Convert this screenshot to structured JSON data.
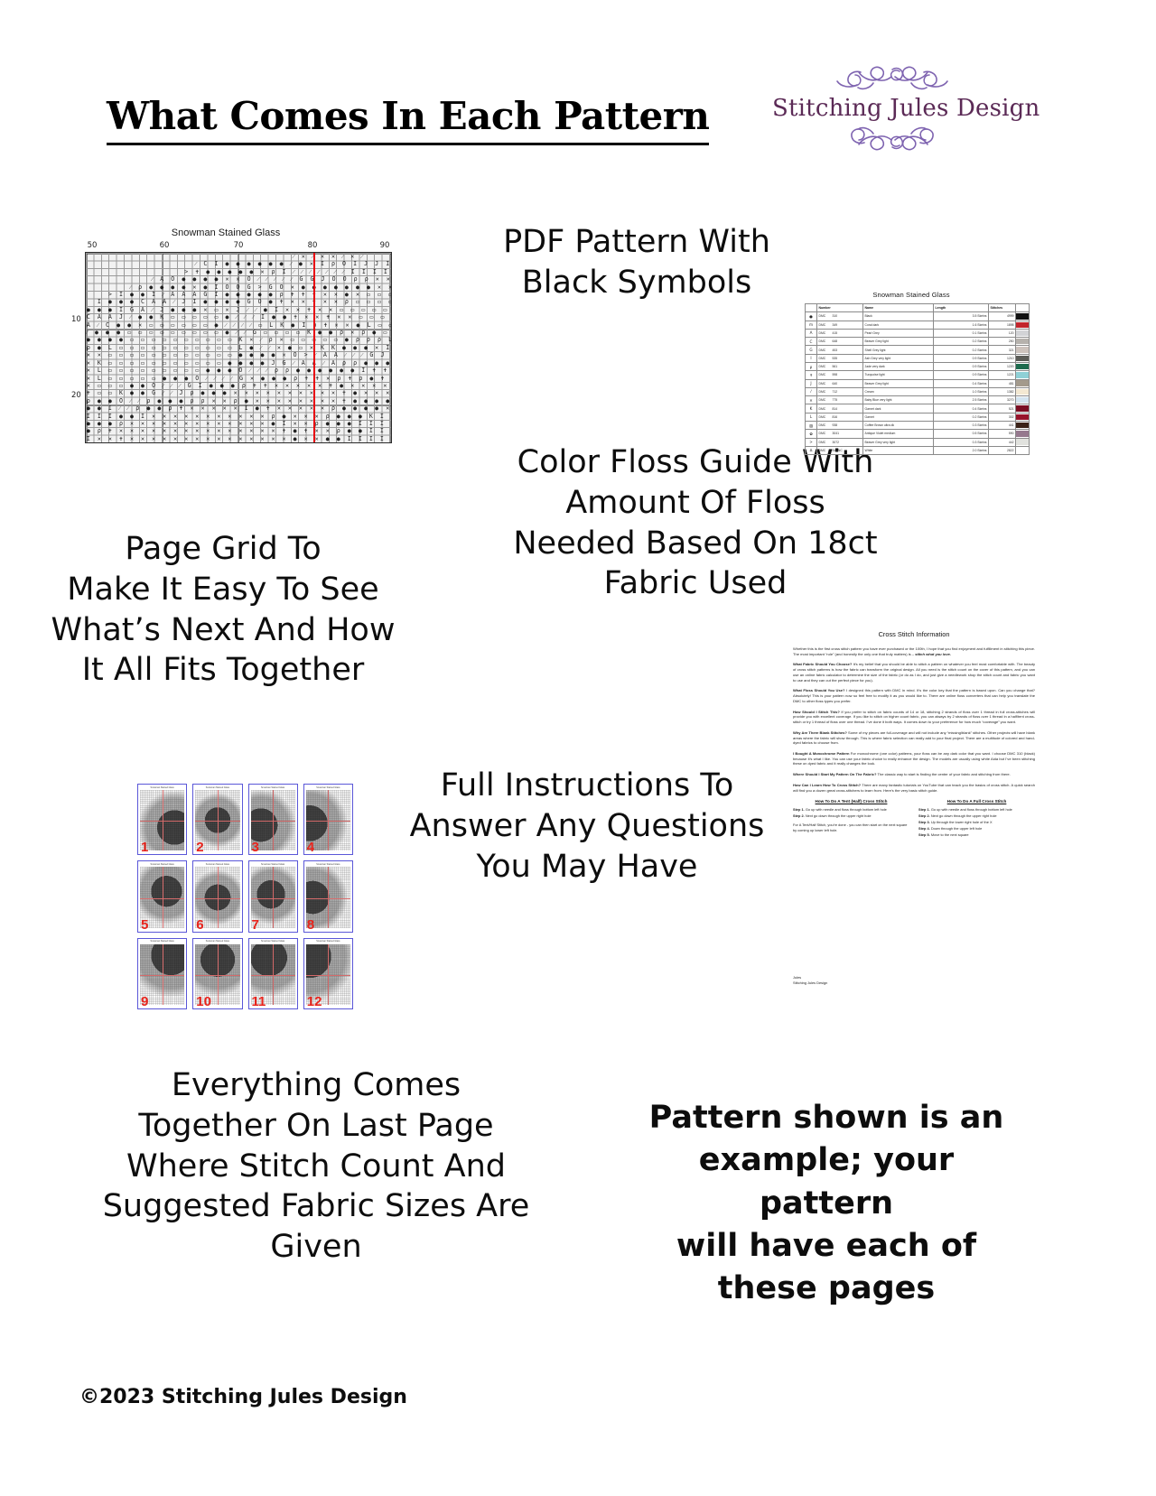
{
  "page": {
    "title": "What Comes In Each Pattern",
    "footer": "©2023 Stitching Jules Design"
  },
  "logo": {
    "name": "Stitching Jules Design",
    "color": "#5b2a56",
    "flourish_color": "#7e63b0"
  },
  "captions": {
    "pdf_pattern": "PDF Pattern With\nBlack Symbols",
    "page_grid": "Page Grid To\nMake It Easy To See\nWhat’s Next And How\nIt All Fits Together",
    "color_floss": "Color Floss Guide With\nAmount Of Floss\nNeeded Based On 18ct\nFabric Used",
    "full_instructions": "Full Instructions To\nAnswer Any Questions\nYou May Have",
    "everything_comes": "Everything Comes\nTogether On Last Page\nWhere Stitch Count And\nSuggested Fabric Sizes Are\nGiven",
    "disclaimer": "Pattern shown is an\nexample; your pattern\nwill have each of\nthese pages"
  },
  "chart": {
    "title": "Snowman Stained Glass",
    "column_labels": [
      "50",
      "60",
      "70",
      "80",
      "90"
    ],
    "row_labels": [
      "10",
      "20"
    ],
    "centerline_color": "#e8000d",
    "symbol_rows": [
      "                                      ⁄ ✕ ⁄ ✕ ✕ ⁄ ✕ ⁄",
      "                    ⁄ C I ● ● ● ● ● ● ⁄ ● ✕ I ρ O I J J I I I I I I I O O O ρ ● ● ● ● I",
      "                  > ✝ ● ● ● ● ● ✕ ρ I ⁄ ⁄ ⁄ ⁄ ⁄ ⁄ ⁄ I I I I I I I ⁄ ⁄ ⁄ ⁄ ⁄ G J I ● ●",
      "            ⁄ A O ● ● ● ● ✕ ✕ O ⁄ ⁄ ⁄ ⁄ ⁄ G G J O O ρ ρ ✕ ✕ ✕ ρ ρ O I J G ⁄ ⁄ A A ⁄ J",
      "        ⁄ ρ ● ● ● ● ✕ ● I O O G > G O ✕ ● ● ● ● ● ● ● ✕ ✕ ● ● ● ● ● ● ● ✕ I G ⁄ A A ⁄",
      "    > I ● ● I ⁄ A A A G I ● ● ● ● ● ρ ✝ ✝ ✝ ✕ ✕ ● ✕ ▭ ▭ ▭ ▭ ● O ⁄ ● ● ● ● ● ρ ✕ ✕ ✝ ✝ ✕",
      "  I ● ● ● C A A ⁄ J I ● ● ● ● G O ● ✝ ✕ ✕ ✝ ✕ ✕ ρ ▭ ▭ ▭ ▭ ▭ ● O ▭ ● ● ● ● ● ✝ ✕ ✝ ✕ ✕ ✝",
      "● ● ● I G A ⁄ J ● ● ● ✕ ▭ ✕ J ⁄ ⁄ ● I ✕ ✕ ✝ ✕ ✕ ▭ ▭ ▭ ▭ ▭ ● O I ✕ ▭ ▭ ▭ ▭ ● ✕ ✕ ✝ ✕ ✕ ✝ ✕",
      "C A A J ⁄ ● ● K ▭ ▭ ▭ ▭ ▭ ● ⁄ ⁄ ⁄ I ● ● ✝ ✕ ✕ ✝ ✕ ✕ ▭ ▭ ▭ ▭ ● O ✕ ▭ ▭ ▭ ▭ L ● ✝ ✕ ✝ ✕ ✝ ● G",
      "A ⁄ C ● ● ✕ ▭ ▭ ▭ ▭ ▭ ▭ ● ⁄ ⁄ ⁄ ⁄ ▭ L K ● I ρ ✝ ✕ ✕ ● L ▭ ▭ ▭ ● I ● ● ● ● ✕ ✝ ρ ▭ ● ▭ ▭ C",
      "⁄ ● ● ● ▭ ▭ ▭ ▭ ▭ ▭ ▭ ▭ ▭ ● ⁄ ⁄ G ▭ ▭ ▭ ▭ K ● ● ρ ✕ ρ ● ▭ L ● J G ✕ ● ▭ ● ✝ ✕ ● ● L ▭ ▭ ▭ ✕",
      "● ● ● ● ▭ ▭ ▭ ▭ ▭ ▭ ▭ ▭ ▭ ▭ K ✕ ⁄ ρ ✕ ▭ ▭ ▭ ▭ ▭ ● ρ ρ ρ L ● C I ▭ ✕ L ● ✝ ρ ● ▭ ▭ ▭ ▭ ▭ ●",
      "ρ ● L ▭ ▭ ▭ ▭ ▭ ▭ ▭ ▭ ▭ ▭ ▭ L ● ⁄ ⁄ ✕ ● ▭ ✕ K K ● ● ● ✕ I O C O ▭ I ρ O O O O ρ I ✕ ● ● ● ● L ▭ ●",
      "✕ ✕ ▭ ▭ ▭ ▭ ▭ ▭ ▭ ▭ ▭ ▭ ▭ ▭ ● ● ● ● ✕ O > ⁄ A A ⁄ ⁄ ⁄ G J J O O I O O ρ O O G > ⁄ A A A A C ●",
      "✕ K ▭ ▭ ▭ ▭ ▭ ▭ ▭ ▭ ▭ ▭ ▭ ● ● ● ● J G ⁄ A A ⁄ A ρ ρ ● ● ● ● ● ● ● ● ● ● ● ● ● ● ● I C J A A A A ⁄",
      "✕ L ▭ ▭ ▭ ▭ ▭ ▭ ▭ ▭ ▭ ● ● ● O ⁄ ⁄ ⁄ ρ ρ ● ● ● ● ● ● I ✝ ✝ ✕ ✕ ✕ ✕ ✕ ✝ ✕ ✕ ✕ ✕ ✝ ✝ ρ ρ I ● ● ● ● ρ",
      "✕ L ▭ ▭ ▭ ▭ ▭ ● ● ● O ⁄ ⁄ ⁄ ⁄ G ✕ ● ● ● ρ ✝ ✝ ✕ ρ ✝ ρ ● ✝ ✕ ✕ ✕ ✕ ✕ ✕ ✕ ✕ ✕ ✕ ✕ ✕ ✕ ρ ● ● ● ● ρ",
      "✕ ▭ ▭ ▭ ● ● O ⁄ ⁄ ⁄ G I ● ● ● ρ ✝ ✝ ✕ ✕ ✕ ✕ ✕ ✝ ● ✕ ✕ ✕ ✕ ✕ ✕ ✝ ρ ✝ ✝ ✕ ✕ ✕ ✕ ✕ ✕ ✕ ✕ I ✕",
      "✝ ▭ ▭ K ● ● G ⁄ ⁄ J ρ ● ● ● ✕ ✕ ✕ ✕ ✕ ✕ ✕ ✕ ✕ ✕ ✝ ● ✕ ✕ ✕ ✕ ✕ ✕ ✝ ✝ ✝ ✕ ✕ ✕ ✕ ✕ ✕ ✕ ✕ ✕ I ✕",
      "ρ ● ● O ⁄ ⁄ ρ ● ● ● ρ ρ ✕ ✕ ρ ● ✕ ✕ ✕ ✕ ✕ ✕ ✕ ✕ ✝ ● ● ● ● ● ● ● ● ● ● ● ● ● ● ● ● ● ● I ρ ✝ I I ✕",
      "● ● I ⁄ ⁄ ρ ● ● ρ ✝ ✕ ✕ ✕ ✕ ✕ I ● ✝ ✕ ✕ ✕ ✕ ✕ ρ ● ● ● ● ✕ K K L L L L K K ● ● ● ● ● ● ● ρ ✕",
      "I I I ● ● I ✕ ✕ ✕ ✕ ✕ ✕ ✕ ✕ ✕ ✕ ✕ ρ ● ✕ ✕ ✕ ρ ● ● ● K I I I I I I I I I O K K K ▭ ▭ ▭ ●",
      "● ● ● ρ ✕ ✕ ✕ ✕ ✕ ✕ ✕ ✕ ✕ ✕ ✕ ✕ ✕ ● I ✕ ✕ ρ ● ● ● I I I I I I I I I I I I I I I O ● ● ●",
      "● ρ ✝ ✕ ✕ ✕ ✕ ✕ ✕ ✕ ✕ ✕ ✕ ✕ ✕ ✕ ✕ ✕ ✝ ● ✝ ✕ ✕ ρ ● ● I I I I I I I I I I I I I I I I ● ● ✕",
      "I ✕ ✕ ✝ ✕ ✕ ✕ ✕ ✕ ✕ ✕ ✕ ✕ ✕ ✕ ✕ ✕ ✕ ✕ ● ✕ ✕ ● ● I I I I I I I I I I I I I I I I I I ● ● ✕ K"
    ]
  },
  "floss_guide": {
    "title": "Snowman Stained Glass",
    "headers": [
      "",
      "Number",
      "Name",
      "Length",
      "Stitches",
      ""
    ],
    "rows": [
      {
        "symbol": "●",
        "brand": "DMC",
        "number": "310",
        "name": "Black",
        "length": "3.5 Skeins",
        "stitches": "4999",
        "color": "#111111"
      },
      {
        "symbol": "m",
        "brand": "DMC",
        "number": "349",
        "name": "Coral dark",
        "length": "1.6 Skeins",
        "stitches": "1898",
        "color": "#c2252c"
      },
      {
        "symbol": "A",
        "brand": "DMC",
        "number": "415",
        "name": "Pearl Grey",
        "length": "0.1 Skeins",
        "stitches": "120",
        "color": "#d2d3d6"
      },
      {
        "symbol": "C",
        "brand": "DMC",
        "number": "648",
        "name": "Beaver Grey light",
        "length": "0.2 Skeins",
        "stitches": "250",
        "color": "#b6b2ad"
      },
      {
        "symbol": "G",
        "brand": "DMC",
        "number": "453",
        "name": "Shell Grey light",
        "length": "0.2 Skeins",
        "stitches": "321",
        "color": "#cdc3bd"
      },
      {
        "symbol": "I",
        "brand": "DMC",
        "number": "535",
        "name": "Ash Grey very light",
        "length": "0.9 Skeins",
        "stitches": "1210",
        "color": "#5c5d58"
      },
      {
        "symbol": "ρ",
        "brand": "DMC",
        "number": "561",
        "name": "Jade very dark",
        "length": "0.9 Skeins",
        "stitches": "1220",
        "color": "#1e6b4e"
      },
      {
        "symbol": "✝",
        "brand": "DMC",
        "number": "598",
        "name": "Turquoise light",
        "length": "0.9 Skeins",
        "stitches": "1221",
        "color": "#8fd0d6"
      },
      {
        "symbol": "J",
        "brand": "DMC",
        "number": "640",
        "name": "Beaver Grey light",
        "length": "0.4 Skeins",
        "stitches": "481",
        "color": "#a39a8c"
      },
      {
        "symbol": "⁄",
        "brand": "DMC",
        "number": "712",
        "name": "Cream",
        "length": "1.0 Skeins",
        "stitches": "1382",
        "color": "#f3e8d2"
      },
      {
        "symbol": "✕",
        "brand": "DMC",
        "number": "775",
        "name": "Baby Blue very light",
        "length": "2.5 Skeins",
        "stitches": "3270",
        "color": "#d3e4f0"
      },
      {
        "symbol": "K",
        "brand": "DMC",
        "number": "814",
        "name": "Garnet dark",
        "length": "0.4 Skeins",
        "stitches": "521",
        "color": "#7a0e23"
      },
      {
        "symbol": "L",
        "brand": "DMC",
        "number": "816",
        "name": "Garnet",
        "length": "0.2 Skeins",
        "stitches": "302",
        "color": "#97132b"
      },
      {
        "symbol": "▨",
        "brand": "DMC",
        "number": "938",
        "name": "Coffee Brown ultra dk",
        "length": "0.3 Skeins",
        "stitches": "441",
        "color": "#3a2218"
      },
      {
        "symbol": "✿",
        "brand": "DMC",
        "number": "3041",
        "name": "Antique Violet medium",
        "length": "0.5 Skeins",
        "stitches": "590",
        "color": "#96798e"
      },
      {
        "symbol": ">",
        "brand": "DMC",
        "number": "3072",
        "name": "Beaver Grey very light",
        "length": "0.3 Skeins",
        "stitches": "442",
        "color": "#e1e2de"
      },
      {
        "symbol": "∆",
        "brand": "DMC",
        "number": "BLANC",
        "name": "White",
        "length": "2.0 Skeins",
        "stitches": "2822",
        "color": "#ffffff"
      }
    ]
  },
  "instructions": {
    "title": "Cross Stitch Information",
    "paragraphs": [
      {
        "lead": "",
        "body": "Whether this is the first cross stitch pattern you have ever purchased or the 100th, I hope that you find enjoyment and fulfillment in stitching this piece. The most important “rule” (and honestly the only one that truly matters) is – ",
        "emphasis": "stitch what you love."
      },
      {
        "lead": "What Fabric Should You Choose?",
        "body": " It’s my belief that you should be able to stitch a pattern on whatever you feel most comfortable with. The beauty of cross stitch patterns is how the fabric can transform the original design. All you need is the stitch count on the cover of this pattern, and you can use an online fabric calculator to determine the size of the fabric (or do as I do, and just give a needlework shop the stitch count and fabric you want to use and they can cut the perfect piece for you).",
        "emphasis": ""
      },
      {
        "lead": "What Floss Should You Use?",
        "body": " I designed this pattern with DMC in mind. It’s the color key that the pattern is based upon. Can you change that? Absolutely! This is your pattern now so feel free to modify it as you would like to. There are online floss converters that can help you translate the DMC to other floss types you prefer.",
        "emphasis": ""
      },
      {
        "lead": "How Should I Stitch This?",
        "body": " If you prefer to stitch on fabric counts of 14 or 18, stitching 2 strands of floss over 1 thread in full cross-stitches will provide you with excellent coverage. If you like to stitch on higher count fabric, you can always try 2 strands of floss over 1 thread in a half/tent cross-stitch or try 1 thread of floss over one thread. I’ve done it both ways. It comes down to your preference for how much “coverage” you want.",
        "emphasis": ""
      },
      {
        "lead": "Why Are There Blank Stitches?",
        "body": " Some of my pieces are full-coverage and will not include any “missing/blank” stitches. Other projects will have blank areas where the fabric will show through. This is where fabric selection can really add to your final project. There are a multitude of colored and hand-dyed fabrics to choose from.",
        "emphasis": ""
      },
      {
        "lead": "I Bought A Monochrome Pattern",
        "body": " For monochrome (one color) patterns, your floss can be any dark color that you want. I choose DMC 310 (black) because it’s what I like. You can use your fabric choice to really enhance the design. The models are usually using white Aida but I’ve been stitching these on dyed fabric and it really changes the look.",
        "emphasis": ""
      },
      {
        "lead": "Where Should I Start My Pattern On The Fabric?",
        "body": " The classic way to start is finding the center of your fabric and stitching from there.",
        "emphasis": ""
      },
      {
        "lead": "How Can I Learn How To Cross Stitch?",
        "body": " There are many fantastic tutorials on YouTube that can teach you the basics of cross stitch. A quick search will find you a dozen great cross-stitchers to learn from. Here’s the very basic stitch guide.",
        "emphasis": ""
      }
    ],
    "howto_left": {
      "heading": "How To Do A Tent (Half) Cross Stitch",
      "steps": [
        {
          "label": "Step 1.",
          "text": " Go up with needle and floss through bottom left hole"
        },
        {
          "label": "Step 2.",
          "text": " Next go down through the upper right hole"
        }
      ],
      "note": "For A Tent/Half Stitch, you’re done - you can then start on the next square by coming up lower left hole."
    },
    "howto_right": {
      "heading": "How To Do A Full Cross Stitch",
      "steps": [
        {
          "label": "Step 1.",
          "text": " Go up with needle and floss through bottom left hole"
        },
        {
          "label": "Step 2.",
          "text": " Next go down through the upper right hole"
        },
        {
          "label": "Step 3.",
          "text": " Up through the lower right hole of the X"
        },
        {
          "label": "Step 4.",
          "text": " Down through the upper left hole"
        },
        {
          "label": "Step 5.",
          "text": " Move to the next square"
        }
      ],
      "note": ""
    },
    "signature": [
      "Jules",
      "Stitching Jules Design"
    ]
  },
  "page_grid": {
    "thumb_title": "Snowman Stained Glass",
    "numbers": [
      "1",
      "2",
      "3",
      "4",
      "5",
      "6",
      "7",
      "8",
      "9",
      "10",
      "11",
      "12"
    ],
    "border_color": "#5a57d8",
    "number_color": "#e8241c"
  }
}
